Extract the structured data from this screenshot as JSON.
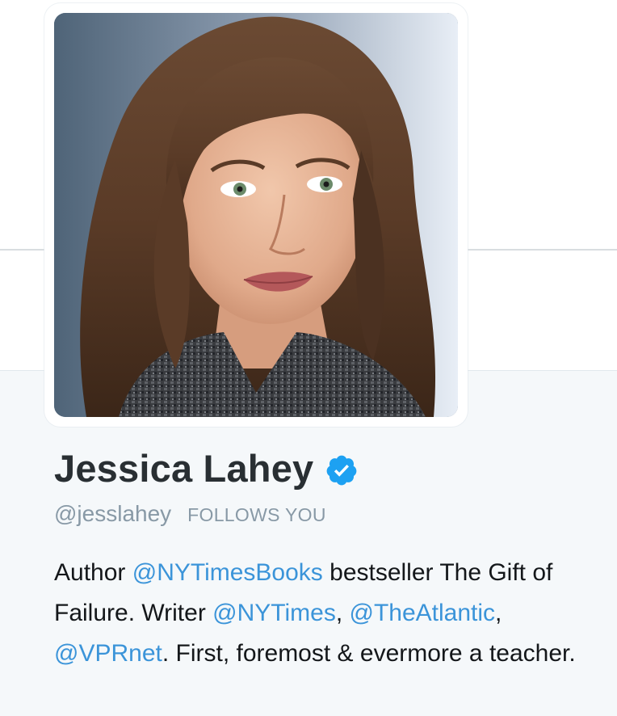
{
  "profile": {
    "name": "Jessica Lahey",
    "handle": "@jesslahey",
    "follows_you": "FOLLOWS YOU",
    "avatar_alt": "Jessica Lahey profile photo",
    "verified_icon": "verified-badge-icon"
  },
  "bio": {
    "t1": "Author ",
    "m1": "@NYTimesBooks",
    "t2": " bestseller The Gift of Failure. Writer ",
    "m2": "@NYTimes",
    "t3": ", ",
    "m3": "@TheAtlantic",
    "t4": ", ",
    "m4": "@VPRnet",
    "t5": ". First, foremost & evermore a teacher."
  },
  "colors": {
    "link": "#3b94d9",
    "verified": "#1da1f2",
    "name": "#292f33",
    "muted": "#8899a6",
    "sidebar_bg": "#f5f8fa"
  }
}
